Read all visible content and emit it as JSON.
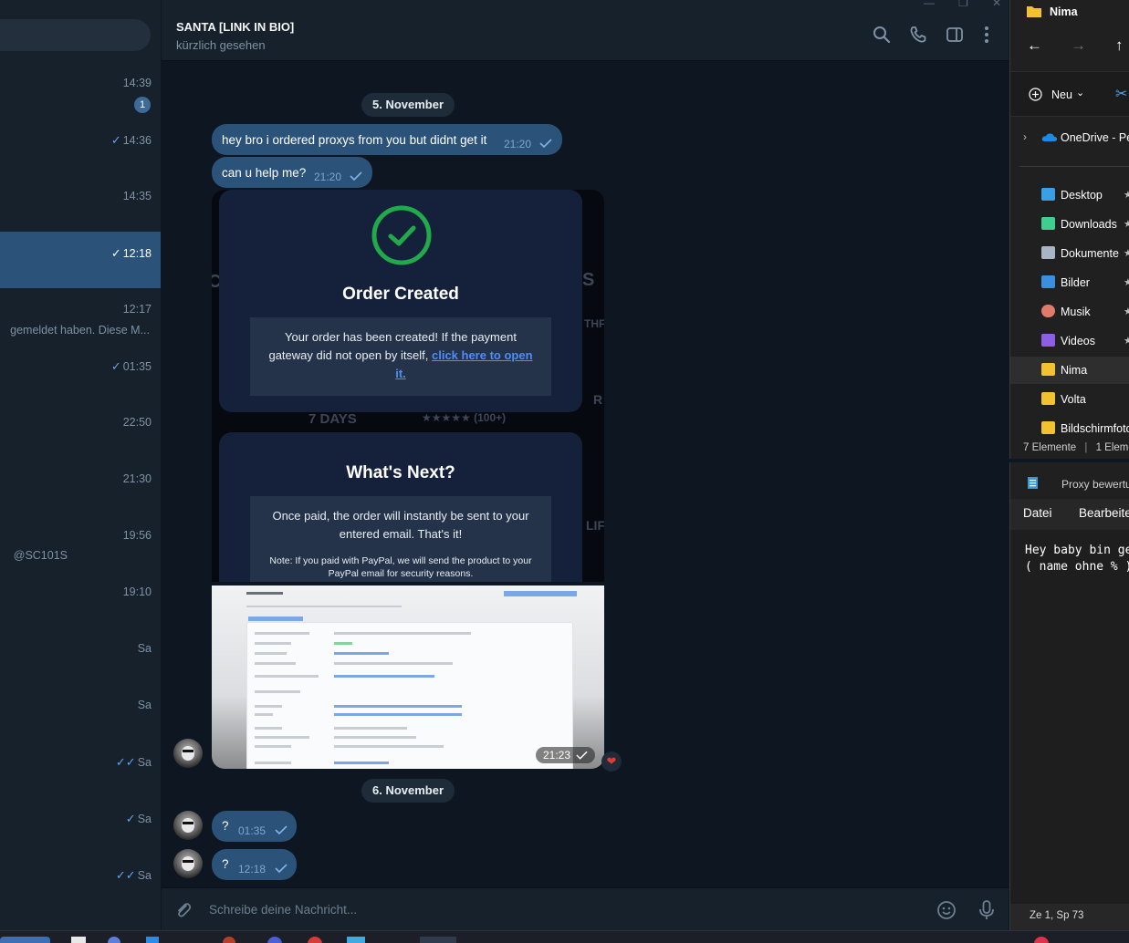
{
  "chat_list": {
    "rows": [
      {
        "time": "14:39",
        "badge": "1",
        "check": "",
        "preview": "",
        "active": false
      },
      {
        "time": "14:36",
        "badge": "",
        "check": "✓",
        "preview": "",
        "active": false
      },
      {
        "time": "14:35",
        "badge": "",
        "check": "",
        "preview": "",
        "active": false
      },
      {
        "time": "12:18",
        "badge": "",
        "check": "✓",
        "preview": "",
        "active": true
      },
      {
        "time": "12:17",
        "badge": "",
        "check": "",
        "preview": "gemeldet haben. Diese M...",
        "active": false
      },
      {
        "time": "01:35",
        "badge": "",
        "check": "✓",
        "preview": "",
        "active": false
      },
      {
        "time": "22:50",
        "badge": "",
        "check": "",
        "preview": "",
        "active": false
      },
      {
        "time": "21:30",
        "badge": "",
        "check": "",
        "preview": "",
        "active": false
      },
      {
        "time": "19:56",
        "badge": "",
        "check": "",
        "preview": "@SC101S",
        "active": false
      },
      {
        "time": "19:10",
        "badge": "",
        "check": "",
        "preview": "",
        "active": false
      },
      {
        "time": "Sa",
        "badge": "",
        "check": "",
        "preview": "",
        "active": false
      },
      {
        "time": "Sa",
        "badge": "",
        "check": "",
        "preview": "",
        "active": false
      },
      {
        "time": "Sa",
        "badge": "",
        "check": "✓✓",
        "preview": "",
        "active": false
      },
      {
        "time": "Sa",
        "badge": "",
        "check": "✓",
        "preview": "",
        "active": false
      },
      {
        "time": "Sa",
        "badge": "",
        "check": "✓✓",
        "preview": "",
        "active": false
      }
    ]
  },
  "chat": {
    "name": "SANTA [LINK IN BIO]",
    "status": "kürzlich gesehen",
    "date1": "5. November",
    "date2": "6. November",
    "messages": [
      {
        "text": "hey bro i ordered proxys from you but didnt get it",
        "time": "21:20"
      },
      {
        "text": "can u help me?",
        "time": "21:20"
      },
      {
        "text": "?",
        "time": "01:35"
      },
      {
        "text": "?",
        "time": "12:18"
      }
    ],
    "image_time": "21:23",
    "compose_placeholder": "Schreibe deine Nachricht..."
  },
  "order_image": {
    "card1_title": "Order Created",
    "card1_text": "Your order has been created! If the payment gateway did not open by itself,",
    "card1_link": "click here to open it.",
    "card2_title": "What's Next?",
    "card2_text": "Once paid, the order will instantly be sent to your entered email. That's it!",
    "card2_note": "Note: If you paid with PayPal, we will send the product to your PayPal email for security reasons.",
    "bg_days": "7 DAYS",
    "bg_rating": "★★★★★ (100+)"
  },
  "explorer": {
    "title": "Nima",
    "new_label": "Neu",
    "onedrive": "OneDrive - Per",
    "items": [
      {
        "label": "Desktop",
        "icon": "desktop-icon",
        "color": "#3aa0e6",
        "selected": false
      },
      {
        "label": "Downloads",
        "icon": "download-icon",
        "color": "#3ecf8e",
        "selected": false
      },
      {
        "label": "Dokumente",
        "icon": "document-icon",
        "color": "#a9b4c6",
        "selected": false
      },
      {
        "label": "Bilder",
        "icon": "picture-icon",
        "color": "#3b8fe0",
        "selected": false
      },
      {
        "label": "Musik",
        "icon": "music-icon",
        "color": "#e07b6a",
        "selected": false
      },
      {
        "label": "Videos",
        "icon": "video-icon",
        "color": "#8e5ee6",
        "selected": false
      },
      {
        "label": "Nima",
        "icon": "folder-icon",
        "color": "#f2c230",
        "selected": true
      },
      {
        "label": "Volta",
        "icon": "folder-icon",
        "color": "#f2c230",
        "selected": false
      },
      {
        "label": "Bildschirmfoto",
        "icon": "folder-icon",
        "color": "#f2c230",
        "selected": false
      }
    ],
    "status_count": "7 Elemente",
    "status_selected": "1 Eleme"
  },
  "notepad": {
    "title": "Proxy bewertu",
    "menu_file": "Datei",
    "menu_edit": "Bearbeite",
    "line1": "Hey baby bin ge",
    "line2": "( name ohne % )",
    "status": "Ze 1, Sp 73"
  },
  "colors": {
    "accent": "#2b5278",
    "check": "#5fa6e8",
    "order_check": "#22a94b"
  }
}
